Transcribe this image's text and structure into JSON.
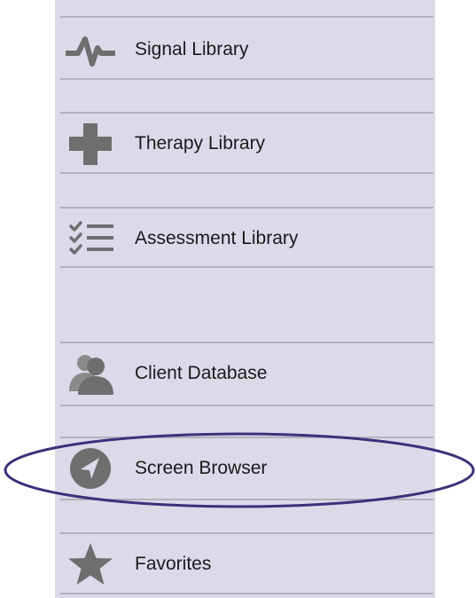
{
  "sidebar": {
    "items": [
      {
        "label": "Signal Library",
        "icon": "waveform-icon"
      },
      {
        "label": "Therapy Library",
        "icon": "medical-cross-icon"
      },
      {
        "label": "Assessment Library",
        "icon": "checklist-icon"
      },
      {
        "label": "Client Database",
        "icon": "users-icon"
      },
      {
        "label": "Screen Browser",
        "icon": "navigation-arrow-icon",
        "highlighted": true
      },
      {
        "label": "Favorites",
        "icon": "star-icon"
      }
    ]
  },
  "colors": {
    "panel_background": "#dcdae8",
    "divider": "#b3b1bc",
    "icon": "#6e6e6e",
    "highlight_ring": "#3b3179"
  }
}
